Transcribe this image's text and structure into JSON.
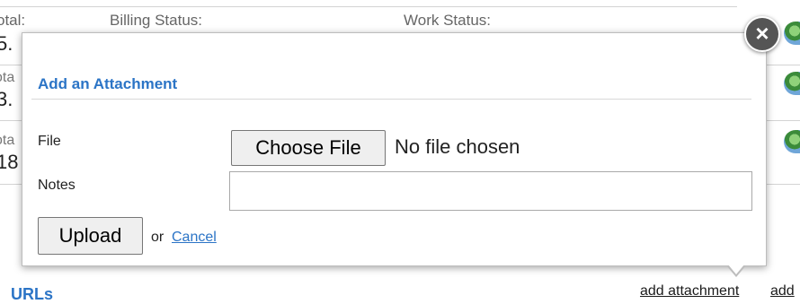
{
  "background": {
    "headers": {
      "total": "otal:",
      "billing_status": "Billing Status:",
      "work_status": "Work Status:"
    },
    "rows": [
      {
        "label": "otal:",
        "value": "5."
      },
      {
        "label": "ota",
        "value": "3."
      },
      {
        "label": "ota",
        "value": "18"
      }
    ],
    "urls_heading": "URLs",
    "add_attachment_link": "add attachment",
    "add_link": "add"
  },
  "dialog": {
    "title": "Add an Attachment",
    "file_label": "File",
    "choose_file_label": "Choose File",
    "file_status": "No file chosen",
    "notes_label": "Notes",
    "notes_value": "",
    "upload_label": "Upload",
    "or_text": "or",
    "cancel_label": "Cancel",
    "close_glyph": "×"
  },
  "colors": {
    "accent": "#2b74c6",
    "close_button": "#555555"
  }
}
